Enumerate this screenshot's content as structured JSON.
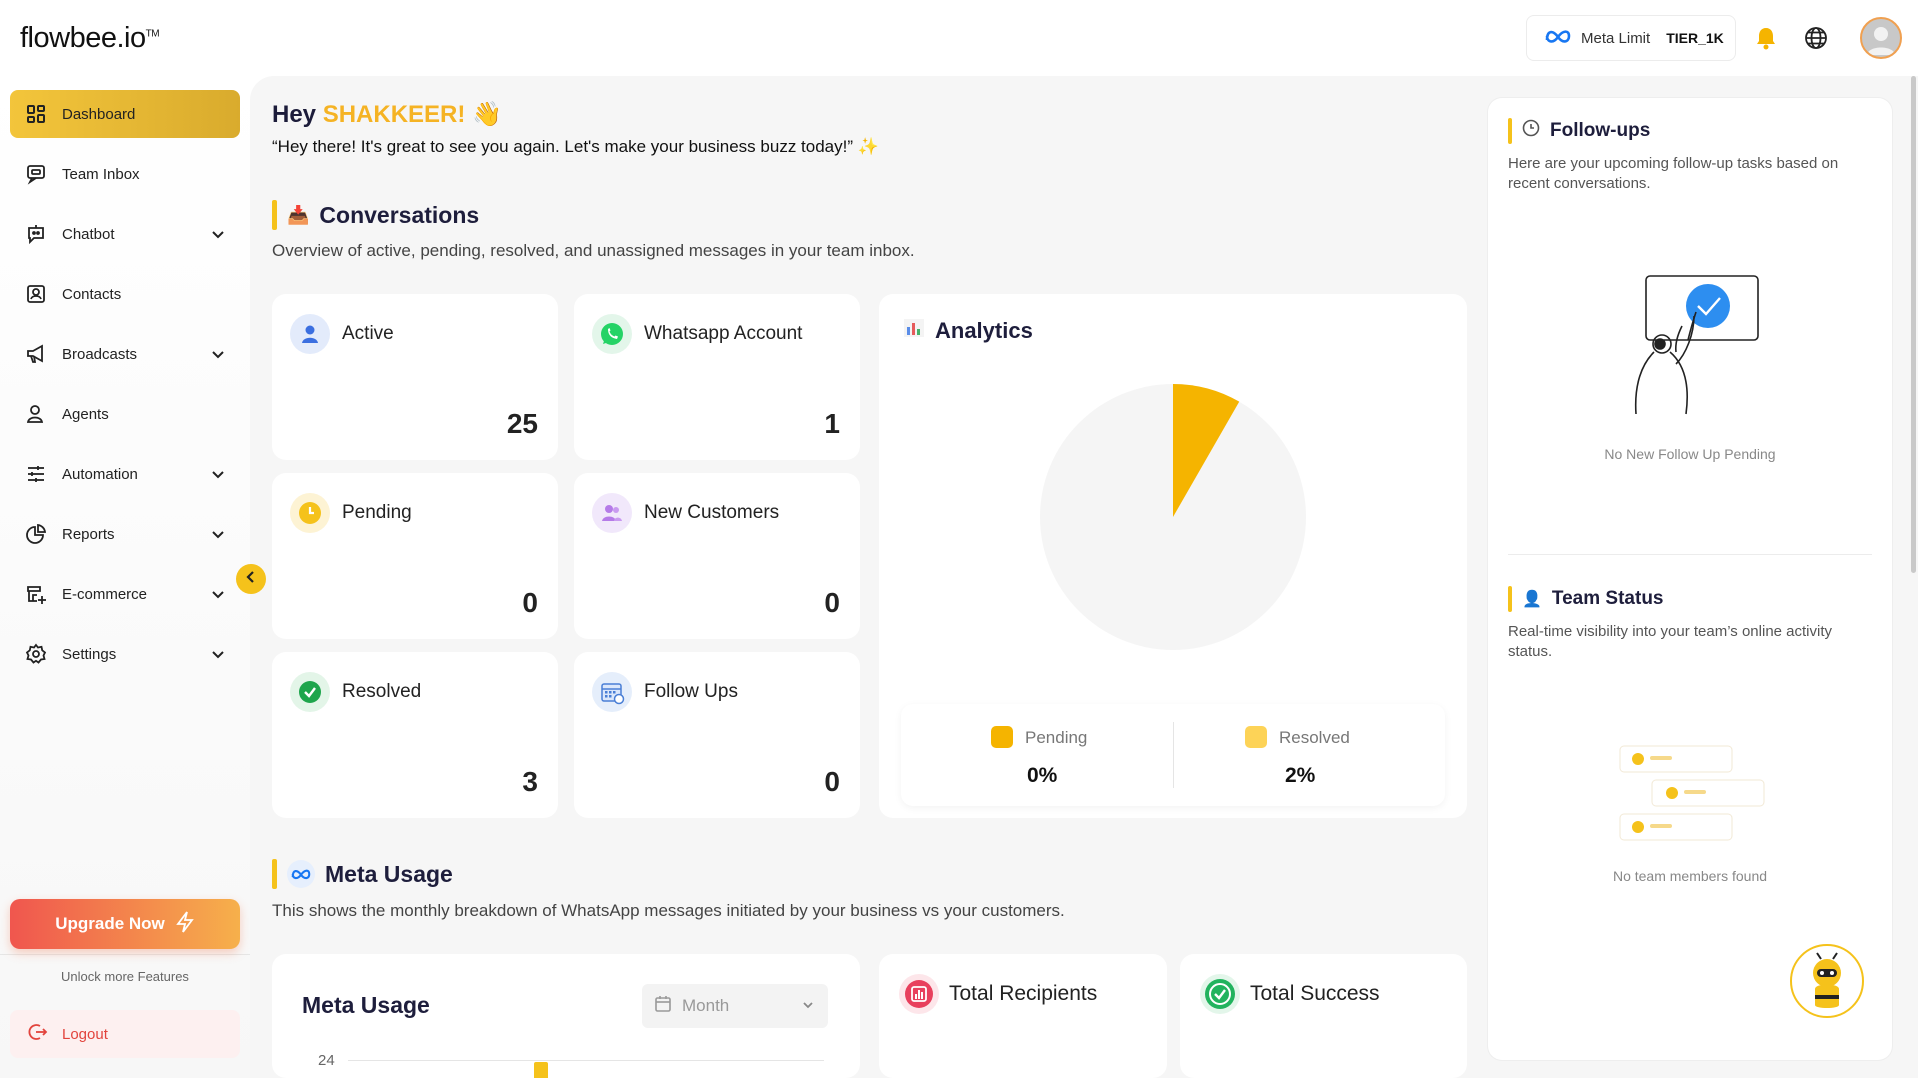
{
  "brand": {
    "logo": "flowbee.io",
    "tm": "TM"
  },
  "header": {
    "meta_limit_label": "Meta Limit",
    "meta_limit_value": "TIER_1K"
  },
  "sidebar": {
    "items": [
      {
        "label": "Dashboard",
        "icon": "dashboard-icon",
        "active": true
      },
      {
        "label": "Team Inbox",
        "icon": "inbox-icon"
      },
      {
        "label": "Chatbot",
        "icon": "chatbot-icon"
      },
      {
        "label": "Contacts",
        "icon": "contacts-icon"
      },
      {
        "label": "Broadcasts",
        "icon": "megaphone-icon"
      },
      {
        "label": "Agents",
        "icon": "agents-icon"
      },
      {
        "label": "Automation",
        "icon": "sliders-icon"
      },
      {
        "label": "Reports",
        "icon": "pie-icon"
      },
      {
        "label": "E-commerce",
        "icon": "store-icon"
      },
      {
        "label": "Settings",
        "icon": "gear-icon"
      }
    ],
    "upgrade_label": "Upgrade Now",
    "unlock_text": "Unlock more Features",
    "logout_label": "Logout"
  },
  "greeting": {
    "hey": "Hey",
    "name": "SHAKKEER!",
    "message": "“Hey there! It's great to see you again. Let's make your business buzz today!”"
  },
  "conversations": {
    "title": "Conversations",
    "subtitle": "Overview of active, pending, resolved, and unassigned messages in your team inbox.",
    "stats": [
      {
        "label": "Active",
        "value": "25"
      },
      {
        "label": "Whatsapp Account",
        "value": "1"
      },
      {
        "label": "Pending",
        "value": "0"
      },
      {
        "label": "New Customers",
        "value": "0"
      },
      {
        "label": "Resolved",
        "value": "3"
      },
      {
        "label": "Follow Ups",
        "value": "0"
      }
    ]
  },
  "analytics": {
    "title": "Analytics",
    "legend": [
      {
        "label": "Pending",
        "value": "0%",
        "color": "#f5b400"
      },
      {
        "label": "Resolved",
        "value": "2%",
        "color": "#fdd357"
      }
    ],
    "pie_share": 0.083,
    "colors": {
      "slice": "#f5b400",
      "rest": "#f5f5f5"
    }
  },
  "meta_usage": {
    "title": "Meta Usage",
    "subtitle": "This shows the monthly breakdown of WhatsApp messages initiated by your business vs your customers.",
    "card_title": "Meta Usage",
    "select_value": "Month",
    "axis_tick": "24",
    "tiles": [
      {
        "label": "Total Recipients"
      },
      {
        "label": "Total Success"
      }
    ]
  },
  "followups": {
    "title": "Follow-ups",
    "subtitle": "Here are your upcoming follow-up tasks based on recent conversations.",
    "empty": "No New Follow Up Pending"
  },
  "team_status": {
    "title": "Team Status",
    "subtitle": "Real-time visibility into your team’s online activity status.",
    "empty": "No team members found"
  }
}
